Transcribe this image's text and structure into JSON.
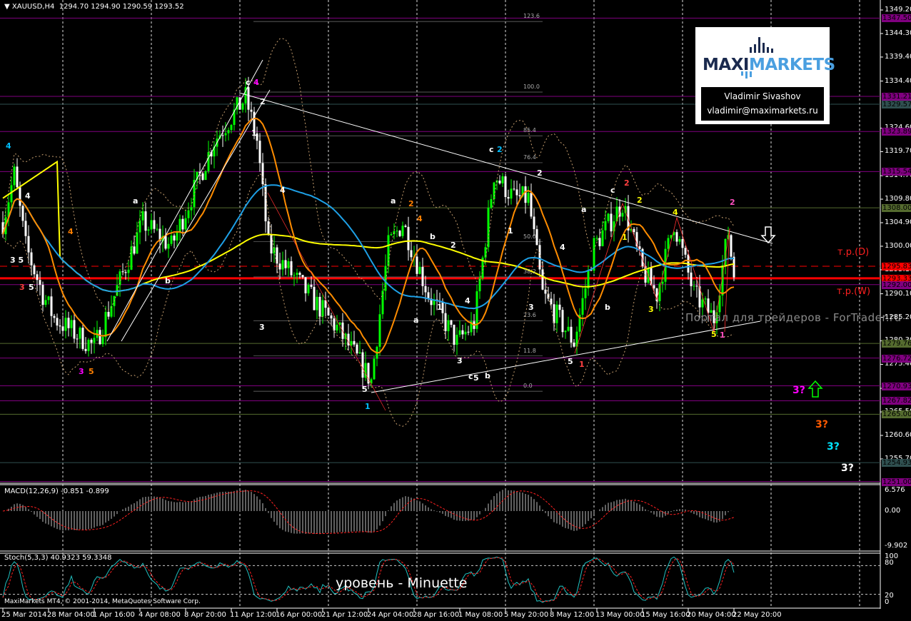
{
  "header": {
    "symbol": "XAUUSD,H4",
    "ohlc": "1294.70 1294.90 1290.59 1293.52"
  },
  "logo": {
    "brand_a": "MAXI",
    "brand_b": "MARKETS",
    "name": "Vladimir Sivashov",
    "email": "vladimir@maximarkets.ru"
  },
  "annotations": {
    "tp_d": "т.р.(D)",
    "tp_w": "т.р.(W)",
    "watermark": "Портал для трейдеров - ForTrader.ru",
    "level_caption": "уровень - Minuette",
    "copyright": "MaxiMarkets MT4, © 2001-2014, MetaQuotes Software Corp."
  },
  "macd": {
    "label": "MACD(12,26,9) -0.851 -0.899",
    "ticks": [
      "6.576",
      "0.00",
      "-9.902"
    ]
  },
  "stoch": {
    "label": "Stoch(5,3,3) 40.9323 59.3348",
    "ticks": [
      "100",
      "80",
      "20",
      "0"
    ]
  },
  "wave_labels": [
    {
      "t": "4",
      "c": "#00bfff"
    },
    {
      "t": "4",
      "c": "#ffffff"
    },
    {
      "t": "4",
      "c": "#ff7f00"
    },
    {
      "t": "3 5",
      "c": "#ffffff"
    },
    {
      "t": "3",
      "c": "#ff4040"
    },
    {
      "t": "5",
      "c": "#ffffff"
    },
    {
      "t": "3",
      "c": "#ff00ff"
    },
    {
      "t": "5",
      "c": "#ff7f00"
    },
    {
      "t": "a",
      "c": "#ffffff"
    },
    {
      "t": "b",
      "c": "#ffffff"
    },
    {
      "t": "c",
      "c": "#ffffff"
    },
    {
      "t": "4",
      "c": "#ff00ff"
    },
    {
      "t": "2",
      "c": "#ffffff"
    },
    {
      "t": "1",
      "c": "#ffffff"
    },
    {
      "t": "4",
      "c": "#ffffff"
    },
    {
      "t": "3",
      "c": "#ffffff"
    },
    {
      "t": "5",
      "c": "#ffffff"
    },
    {
      "t": "1",
      "c": "#00bfff"
    },
    {
      "t": "a",
      "c": "#ffffff"
    },
    {
      "t": "2",
      "c": "#ff7f00"
    },
    {
      "t": "4",
      "c": "#ff7f00"
    },
    {
      "t": "b",
      "c": "#ffffff"
    },
    {
      "t": "2",
      "c": "#ffffff"
    },
    {
      "t": "a",
      "c": "#ffffff"
    },
    {
      "t": "1",
      "c": "#ffffff"
    },
    {
      "t": "4",
      "c": "#ffffff"
    },
    {
      "t": "3",
      "c": "#ffffff"
    },
    {
      "t": "c",
      "c": "#ffffff"
    },
    {
      "t": "5",
      "c": "#ffffff"
    },
    {
      "t": "b",
      "c": "#ffffff"
    },
    {
      "t": "c",
      "c": "#ffffff"
    },
    {
      "t": "2",
      "c": "#00bfff"
    },
    {
      "t": "2",
      "c": "#ffffff"
    },
    {
      "t": "1",
      "c": "#ffffff"
    },
    {
      "t": "4",
      "c": "#ffffff"
    },
    {
      "t": "3",
      "c": "#ffffff"
    },
    {
      "t": "5",
      "c": "#ffffff"
    },
    {
      "t": "1",
      "c": "#ff4040"
    },
    {
      "t": "a",
      "c": "#ffffff"
    },
    {
      "t": "b",
      "c": "#ffffff"
    },
    {
      "t": "c",
      "c": "#ffffff"
    },
    {
      "t": "2",
      "c": "#ff4040"
    },
    {
      "t": "2",
      "c": "#ffff00"
    },
    {
      "t": "1",
      "c": "#ffff00"
    },
    {
      "t": "3",
      "c": "#ffff00"
    },
    {
      "t": "4",
      "c": "#ffff00"
    },
    {
      "t": "2",
      "c": "#ff4fc0"
    },
    {
      "t": "5",
      "c": "#ffff00"
    },
    {
      "t": "1",
      "c": "#ff4fc0"
    }
  ],
  "targets": [
    {
      "t": "3?",
      "c": "#ff00ff"
    },
    {
      "t": "3?",
      "c": "#ff5a00"
    },
    {
      "t": "3?",
      "c": "#00e5ff"
    },
    {
      "t": "3?",
      "c": "#ffffff"
    }
  ],
  "chart_data": {
    "type": "line",
    "title": "XAUUSD,H4",
    "description_series": "close price path (bar index, price) rendered as candlesticks",
    "ylim": [
      1251.0,
      1349.2
    ],
    "y_ticks": [
      "1349.20",
      "1344.30",
      "1339.40",
      "1334.40",
      "1324.60",
      "1319.70",
      "1314.70",
      "1309.80",
      "1304.90",
      "1300.00",
      "1295.10",
      "1290.10",
      "1285.20",
      "1280.30",
      "1275.40",
      "1270.40",
      "1265.50",
      "1260.60",
      "1255.70"
    ],
    "x_ticks": [
      {
        "bar": 0,
        "label": "25 Mar 2014"
      },
      {
        "bar": 16,
        "label": "28 Mar 04:00"
      },
      {
        "bar": 32,
        "label": "1 Apr 16:00"
      },
      {
        "bar": 48,
        "label": "4 Apr 08:00"
      },
      {
        "bar": 64,
        "label": "8 Apr 20:00"
      },
      {
        "bar": 80,
        "label": "11 Apr 12:00"
      },
      {
        "bar": 96,
        "label": "16 Apr 00:00"
      },
      {
        "bar": 112,
        "label": "21 Apr 12:00"
      },
      {
        "bar": 128,
        "label": "24 Apr 04:00"
      },
      {
        "bar": 144,
        "label": "28 Apr 16:00"
      },
      {
        "bar": 160,
        "label": "1 May 08:00"
      },
      {
        "bar": 176,
        "label": "5 May 20:00"
      },
      {
        "bar": 192,
        "label": "8 May 12:00"
      },
      {
        "bar": 208,
        "label": "13 May 00:00"
      },
      {
        "bar": 224,
        "label": "15 May 16:00"
      },
      {
        "bar": 240,
        "label": "20 May 04:00"
      },
      {
        "bar": 256,
        "label": "22 May 20:00"
      }
    ],
    "price_path": [
      [
        0,
        1305
      ],
      [
        4,
        1315
      ],
      [
        8,
        1300
      ],
      [
        14,
        1290
      ],
      [
        18,
        1285
      ],
      [
        32,
        1279
      ],
      [
        49,
        1305
      ],
      [
        59,
        1300
      ],
      [
        74,
        1322
      ],
      [
        85,
        1331
      ],
      [
        89,
        1322
      ],
      [
        93,
        1300
      ],
      [
        107,
        1290
      ],
      [
        117,
        1283
      ],
      [
        129,
        1272
      ],
      [
        135,
        1300
      ],
      [
        140,
        1305
      ],
      [
        149,
        1290
      ],
      [
        159,
        1280
      ],
      [
        165,
        1284
      ],
      [
        172,
        1315
      ],
      [
        179,
        1310
      ],
      [
        184,
        1310
      ],
      [
        189,
        1290
      ],
      [
        200,
        1280
      ],
      [
        207,
        1300
      ],
      [
        217,
        1309
      ],
      [
        224,
        1295
      ],
      [
        229,
        1290
      ],
      [
        235,
        1305
      ],
      [
        242,
        1290
      ],
      [
        249,
        1285
      ],
      [
        254,
        1303
      ],
      [
        256,
        1293.52
      ]
    ],
    "levels": [
      {
        "price": 1347.5,
        "label": "1347.50",
        "color": "#800080"
      },
      {
        "price": 1331.21,
        "label": "1331.21",
        "color": "#800080"
      },
      {
        "price": 1329.57,
        "label": "1329.57",
        "color": "#2f4f4f"
      },
      {
        "price": 1323.89,
        "label": "1323.89",
        "color": "#800080"
      },
      {
        "price": 1315.54,
        "label": "1315.54",
        "color": "#800080"
      },
      {
        "price": 1308.0,
        "label": "1308.00",
        "color": "#556b2f"
      },
      {
        "price": 1295.83,
        "label": "1295.83",
        "color": "#ff0000",
        "style": "dashed"
      },
      {
        "price": 1293.33,
        "label": "1293.33",
        "color": "#ff0000",
        "style": "thick"
      },
      {
        "price": 1292.0,
        "label": "1292.00",
        "color": "#800080"
      },
      {
        "price": 1279.76,
        "label": "1279.76",
        "color": "#556b2f"
      },
      {
        "price": 1276.72,
        "label": "1276.72",
        "color": "#800080"
      },
      {
        "price": 1270.93,
        "label": "1270.93",
        "color": "#800080"
      },
      {
        "price": 1267.82,
        "label": "1267.82",
        "color": "#800080"
      },
      {
        "price": 1265.0,
        "label": "1265.00",
        "color": "#556b2f"
      },
      {
        "price": 1254.93,
        "label": "1254.93",
        "color": "#2f4f4f"
      },
      {
        "price": 1251.0,
        "label": "1251.00",
        "color": "#800080"
      }
    ],
    "fibonacci": {
      "low": 1269.8,
      "high": 1332.1,
      "levels": [
        "123.6",
        "100.0",
        "85.4",
        "76.4",
        "50.0",
        "38.2",
        "23.6",
        "11.8",
        "0.0"
      ]
    }
  }
}
